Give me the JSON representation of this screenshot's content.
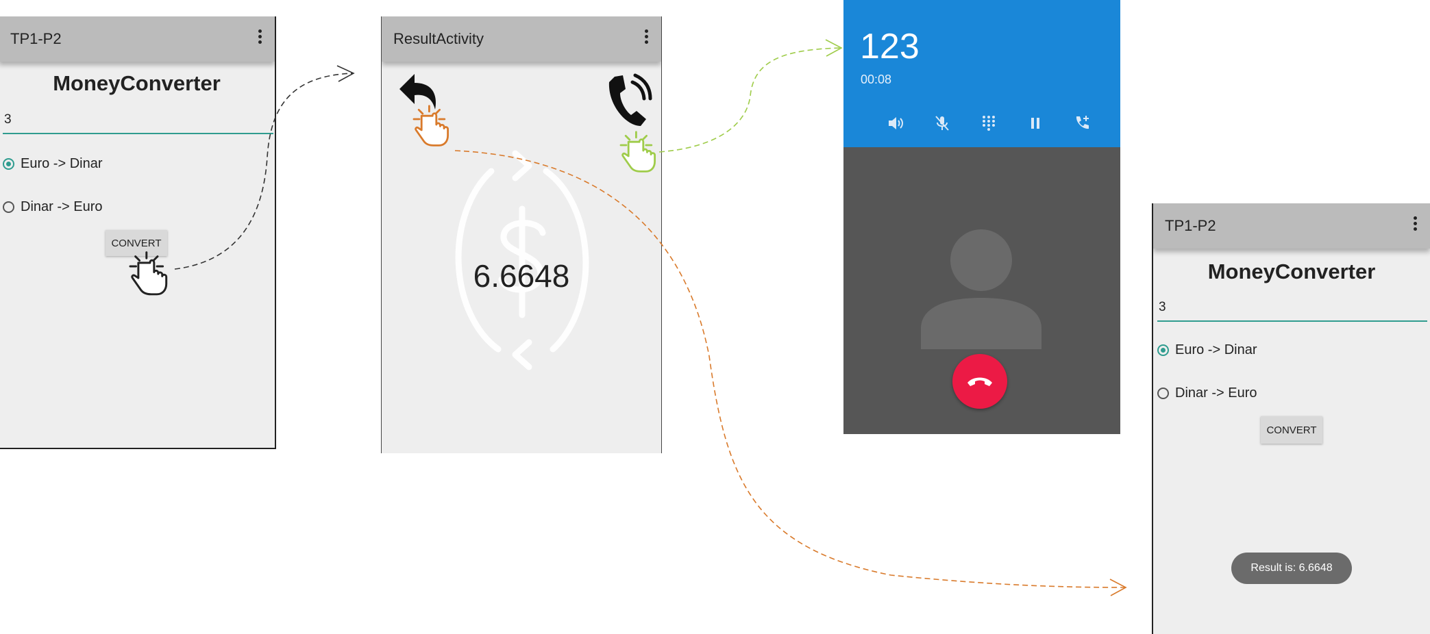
{
  "screen1": {
    "app_title": "TP1-P2",
    "heading": "MoneyConverter",
    "amount_value": "3",
    "options": [
      "Euro -> Dinar",
      "Dinar -> Euro"
    ],
    "selected_option": "Euro -> Dinar",
    "convert_label": "CONVERT"
  },
  "screen2": {
    "app_title": "ResultActivity",
    "result_value": "6.6648",
    "icons": [
      "back-arrow-icon",
      "phone-call-icon",
      "currency-exchange-icon"
    ]
  },
  "screen3": {
    "number": "123",
    "timer": "00:08",
    "actions": [
      "speaker-icon",
      "mute-icon",
      "dialpad-icon",
      "hold-icon",
      "add-call-icon"
    ],
    "header_color": "#1a87d8",
    "hangup_color": "#ec1a45"
  },
  "screen4": {
    "app_title": "TP1-P2",
    "heading": "MoneyConverter",
    "amount_value": "3",
    "options": [
      "Euro -> Dinar",
      "Dinar -> Euro"
    ],
    "selected_option": "Euro -> Dinar",
    "convert_label": "CONVERT",
    "toast": "Result is: 6.6648"
  },
  "colors": {
    "accent": "#2f9c8f",
    "back_flow": "#d97a2b",
    "call_flow": "#9fcc4a",
    "convert_flow": "#333333"
  }
}
